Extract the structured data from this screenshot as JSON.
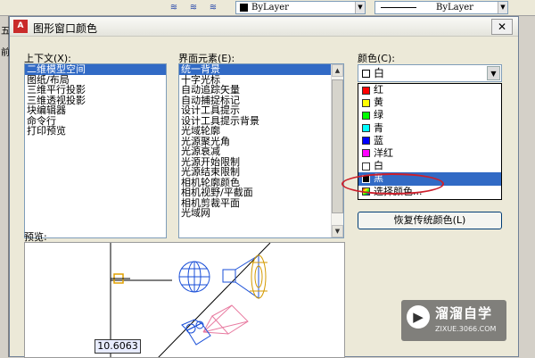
{
  "toolbar": {
    "color_combo": "ByLayer",
    "linetype_combo": "ByLayer"
  },
  "left_edge": {
    "chars": [
      "五",
      "前"
    ]
  },
  "dialog": {
    "title": "图形窗口颜色",
    "app_icon": "A",
    "close_label": "✕",
    "context": {
      "label": "上下文(X):",
      "items": [
        "二维模型空间",
        "图纸/布局",
        "三维平行投影",
        "三维透视投影",
        "块编辑器",
        "命令行",
        "打印预览"
      ],
      "selected_index": 0
    },
    "element": {
      "label": "界面元素(E):",
      "items": [
        "统一背景",
        "十字光标",
        "自动追踪矢量",
        "自动捕捉标记",
        "设计工具提示",
        "设计工具提示背景",
        "光域轮廓",
        "光源聚光角",
        "光源衰减",
        "光源开始限制",
        "光源结束限制",
        "相机轮廓颜色",
        "相机视野/平截面",
        "相机剪裁平面",
        "光域网"
      ],
      "selected_index": 0
    },
    "color": {
      "label": "颜色(C):",
      "selected_value": "白",
      "options": [
        {
          "name": "红",
          "swatch": "#ff0000"
        },
        {
          "name": "黄",
          "swatch": "#ffff00"
        },
        {
          "name": "绿",
          "swatch": "#00ff00"
        },
        {
          "name": "青",
          "swatch": "#00ffff"
        },
        {
          "name": "蓝",
          "swatch": "#0000ff"
        },
        {
          "name": "洋红",
          "swatch": "#ff00ff"
        },
        {
          "name": "白",
          "swatch": "#ffffff"
        },
        {
          "name": "黑",
          "swatch": "#000000"
        },
        {
          "name": "选择颜色...",
          "swatch": "multicolor"
        }
      ],
      "highlighted_index": 7
    },
    "restore_button": "恢复传统颜色(L)",
    "preview": {
      "label": "预览:",
      "coord_value": "10.6063"
    }
  },
  "watermark": {
    "brand": "溜溜自学",
    "url": "ZIXUE.3066.COM"
  },
  "colors": {
    "selection_blue": "#316ac5",
    "annotation_red": "#cc1f2b",
    "preview_blue": "#1a4fd8"
  }
}
